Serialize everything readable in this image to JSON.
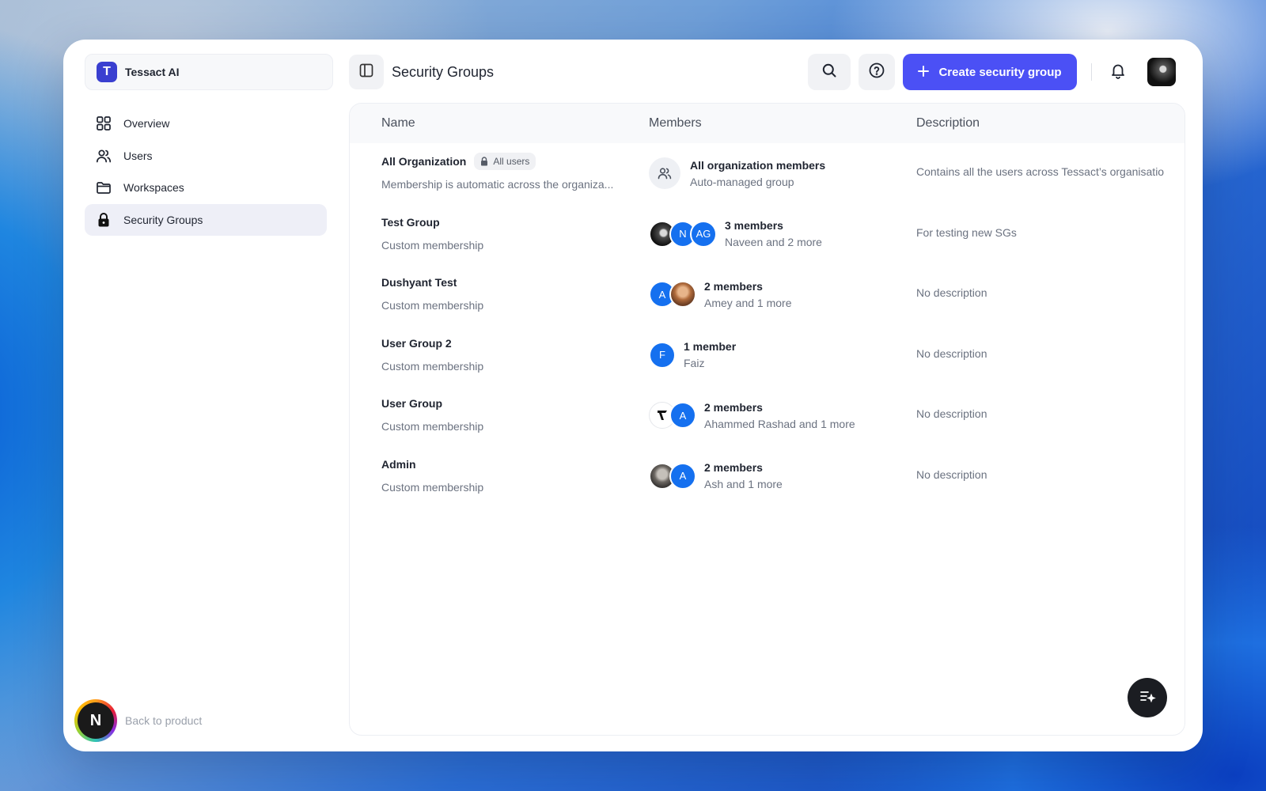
{
  "org": {
    "initial": "T",
    "name": "Tessact AI"
  },
  "sidebar": {
    "items": [
      {
        "label": "Overview",
        "icon": "grid-icon"
      },
      {
        "label": "Users",
        "icon": "users-icon"
      },
      {
        "label": "Workspaces",
        "icon": "folder-icon"
      },
      {
        "label": "Security Groups",
        "icon": "lock-icon",
        "active": true
      }
    ],
    "back_initial": "N",
    "back_label": "Back to product"
  },
  "header": {
    "title": "Security Groups",
    "create_label": "Create security group"
  },
  "table": {
    "columns": {
      "name": "Name",
      "members": "Members",
      "description": "Description"
    },
    "rows": [
      {
        "name": "All Organization",
        "badge": "All users",
        "sub": "Membership is automatic across the organiza...",
        "members_count": "All organization members",
        "members_names": "Auto-managed group",
        "description": "Contains all the users across Tessact’s organisatio"
      },
      {
        "name": "Test Group",
        "sub": "Custom membership",
        "avatars": [
          "",
          "N",
          "AG"
        ],
        "members_count": "3 members",
        "members_names": "Naveen and 2 more",
        "description": "For testing new SGs"
      },
      {
        "name": "Dushyant Test",
        "sub": "Custom membership",
        "avatars": [
          "A",
          ""
        ],
        "members_count": "2 members",
        "members_names": "Amey and 1 more",
        "description": "No description"
      },
      {
        "name": "User Group 2",
        "sub": "Custom membership",
        "avatars": [
          "F"
        ],
        "members_count": "1 member",
        "members_names": "Faiz",
        "description": "No description"
      },
      {
        "name": "User Group",
        "sub": "Custom membership",
        "avatars": [
          "",
          "A"
        ],
        "members_count": "2 members",
        "members_names": "Ahammed Rashad and 1 more",
        "description": "No description"
      },
      {
        "name": "Admin",
        "sub": "Custom membership",
        "avatars": [
          "",
          "A"
        ],
        "members_count": "2 members",
        "members_names": "Ash and 1 more",
        "description": "No description"
      }
    ]
  },
  "colors": {
    "accent": "#4b50f5",
    "avatar_blue": "#1570ef",
    "org_logo": "#3a3fd0"
  }
}
